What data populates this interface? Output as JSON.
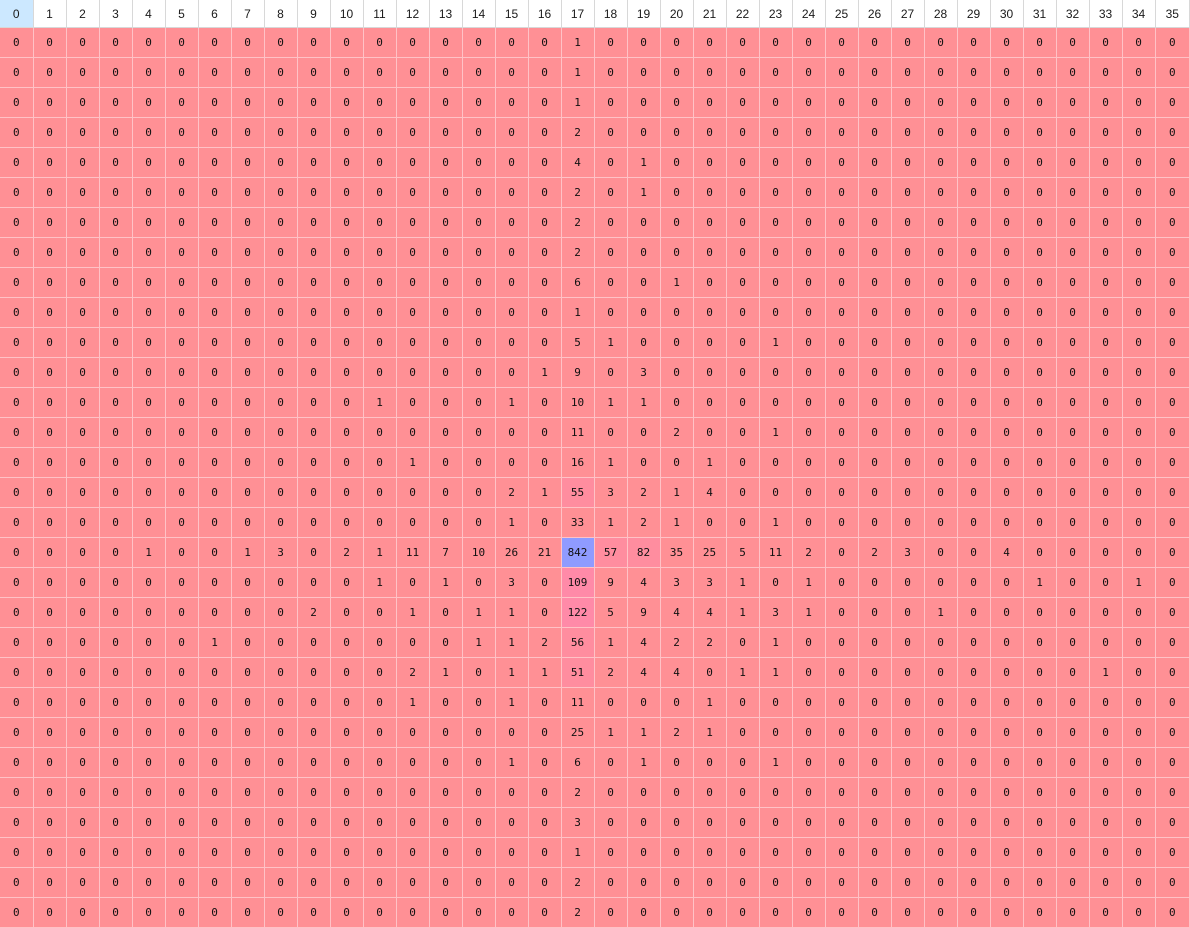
{
  "header": [
    "0",
    "1",
    "2",
    "3",
    "4",
    "5",
    "6",
    "7",
    "8",
    "9",
    "10",
    "11",
    "12",
    "13",
    "14",
    "15",
    "16",
    "17",
    "18",
    "19",
    "20",
    "21",
    "22",
    "23",
    "24",
    "25",
    "26",
    "27",
    "28",
    "29",
    "30",
    "31",
    "32",
    "33",
    "34",
    "35"
  ],
  "selected_header_index": 0,
  "colors": {
    "base_cell": "#ff9095",
    "mid_cell": "#ff8aa8",
    "high_cell": "#8f9bff",
    "cell_border": "#ffc2c6",
    "header_selected": "#cce8ff"
  },
  "rows": [
    [
      0,
      0,
      0,
      0,
      0,
      0,
      0,
      0,
      0,
      0,
      0,
      0,
      0,
      0,
      0,
      0,
      0,
      1,
      0,
      0,
      0,
      0,
      0,
      0,
      0,
      0,
      0,
      0,
      0,
      0,
      0,
      0,
      0,
      0,
      0,
      0
    ],
    [
      0,
      0,
      0,
      0,
      0,
      0,
      0,
      0,
      0,
      0,
      0,
      0,
      0,
      0,
      0,
      0,
      0,
      1,
      0,
      0,
      0,
      0,
      0,
      0,
      0,
      0,
      0,
      0,
      0,
      0,
      0,
      0,
      0,
      0,
      0,
      0
    ],
    [
      0,
      0,
      0,
      0,
      0,
      0,
      0,
      0,
      0,
      0,
      0,
      0,
      0,
      0,
      0,
      0,
      0,
      1,
      0,
      0,
      0,
      0,
      0,
      0,
      0,
      0,
      0,
      0,
      0,
      0,
      0,
      0,
      0,
      0,
      0,
      0
    ],
    [
      0,
      0,
      0,
      0,
      0,
      0,
      0,
      0,
      0,
      0,
      0,
      0,
      0,
      0,
      0,
      0,
      0,
      2,
      0,
      0,
      0,
      0,
      0,
      0,
      0,
      0,
      0,
      0,
      0,
      0,
      0,
      0,
      0,
      0,
      0,
      0
    ],
    [
      0,
      0,
      0,
      0,
      0,
      0,
      0,
      0,
      0,
      0,
      0,
      0,
      0,
      0,
      0,
      0,
      0,
      4,
      0,
      1,
      0,
      0,
      0,
      0,
      0,
      0,
      0,
      0,
      0,
      0,
      0,
      0,
      0,
      0,
      0,
      0
    ],
    [
      0,
      0,
      0,
      0,
      0,
      0,
      0,
      0,
      0,
      0,
      0,
      0,
      0,
      0,
      0,
      0,
      0,
      2,
      0,
      1,
      0,
      0,
      0,
      0,
      0,
      0,
      0,
      0,
      0,
      0,
      0,
      0,
      0,
      0,
      0,
      0
    ],
    [
      0,
      0,
      0,
      0,
      0,
      0,
      0,
      0,
      0,
      0,
      0,
      0,
      0,
      0,
      0,
      0,
      0,
      2,
      0,
      0,
      0,
      0,
      0,
      0,
      0,
      0,
      0,
      0,
      0,
      0,
      0,
      0,
      0,
      0,
      0,
      0
    ],
    [
      0,
      0,
      0,
      0,
      0,
      0,
      0,
      0,
      0,
      0,
      0,
      0,
      0,
      0,
      0,
      0,
      0,
      2,
      0,
      0,
      0,
      0,
      0,
      0,
      0,
      0,
      0,
      0,
      0,
      0,
      0,
      0,
      0,
      0,
      0,
      0
    ],
    [
      0,
      0,
      0,
      0,
      0,
      0,
      0,
      0,
      0,
      0,
      0,
      0,
      0,
      0,
      0,
      0,
      0,
      6,
      0,
      0,
      1,
      0,
      0,
      0,
      0,
      0,
      0,
      0,
      0,
      0,
      0,
      0,
      0,
      0,
      0,
      0
    ],
    [
      0,
      0,
      0,
      0,
      0,
      0,
      0,
      0,
      0,
      0,
      0,
      0,
      0,
      0,
      0,
      0,
      0,
      1,
      0,
      0,
      0,
      0,
      0,
      0,
      0,
      0,
      0,
      0,
      0,
      0,
      0,
      0,
      0,
      0,
      0,
      0
    ],
    [
      0,
      0,
      0,
      0,
      0,
      0,
      0,
      0,
      0,
      0,
      0,
      0,
      0,
      0,
      0,
      0,
      0,
      5,
      1,
      0,
      0,
      0,
      0,
      1,
      0,
      0,
      0,
      0,
      0,
      0,
      0,
      0,
      0,
      0,
      0,
      0
    ],
    [
      0,
      0,
      0,
      0,
      0,
      0,
      0,
      0,
      0,
      0,
      0,
      0,
      0,
      0,
      0,
      0,
      1,
      9,
      0,
      3,
      0,
      0,
      0,
      0,
      0,
      0,
      0,
      0,
      0,
      0,
      0,
      0,
      0,
      0,
      0,
      0
    ],
    [
      0,
      0,
      0,
      0,
      0,
      0,
      0,
      0,
      0,
      0,
      0,
      1,
      0,
      0,
      0,
      1,
      0,
      10,
      1,
      1,
      0,
      0,
      0,
      0,
      0,
      0,
      0,
      0,
      0,
      0,
      0,
      0,
      0,
      0,
      0,
      0
    ],
    [
      0,
      0,
      0,
      0,
      0,
      0,
      0,
      0,
      0,
      0,
      0,
      0,
      0,
      0,
      0,
      0,
      0,
      11,
      0,
      0,
      2,
      0,
      0,
      1,
      0,
      0,
      0,
      0,
      0,
      0,
      0,
      0,
      0,
      0,
      0,
      0
    ],
    [
      0,
      0,
      0,
      0,
      0,
      0,
      0,
      0,
      0,
      0,
      0,
      0,
      1,
      0,
      0,
      0,
      0,
      16,
      1,
      0,
      0,
      1,
      0,
      0,
      0,
      0,
      0,
      0,
      0,
      0,
      0,
      0,
      0,
      0,
      0,
      0
    ],
    [
      0,
      0,
      0,
      0,
      0,
      0,
      0,
      0,
      0,
      0,
      0,
      0,
      0,
      0,
      0,
      2,
      1,
      55,
      3,
      2,
      1,
      4,
      0,
      0,
      0,
      0,
      0,
      0,
      0,
      0,
      0,
      0,
      0,
      0,
      0,
      0
    ],
    [
      0,
      0,
      0,
      0,
      0,
      0,
      0,
      0,
      0,
      0,
      0,
      0,
      0,
      0,
      0,
      1,
      0,
      33,
      1,
      2,
      1,
      0,
      0,
      1,
      0,
      0,
      0,
      0,
      0,
      0,
      0,
      0,
      0,
      0,
      0,
      0
    ],
    [
      0,
      0,
      0,
      0,
      1,
      0,
      0,
      1,
      3,
      0,
      2,
      1,
      11,
      7,
      10,
      26,
      21,
      842,
      57,
      82,
      35,
      25,
      5,
      11,
      2,
      0,
      2,
      3,
      0,
      0,
      4,
      0,
      0,
      0,
      0,
      0
    ],
    [
      0,
      0,
      0,
      0,
      0,
      0,
      0,
      0,
      0,
      0,
      0,
      1,
      0,
      1,
      0,
      3,
      0,
      109,
      9,
      4,
      3,
      3,
      1,
      0,
      1,
      0,
      0,
      0,
      0,
      0,
      0,
      1,
      0,
      0,
      1,
      0
    ],
    [
      0,
      0,
      0,
      0,
      0,
      0,
      0,
      0,
      0,
      2,
      0,
      0,
      1,
      0,
      1,
      1,
      0,
      122,
      5,
      9,
      4,
      4,
      1,
      3,
      1,
      0,
      0,
      0,
      1,
      0,
      0,
      0,
      0,
      0,
      0,
      0
    ],
    [
      0,
      0,
      0,
      0,
      0,
      0,
      1,
      0,
      0,
      0,
      0,
      0,
      0,
      0,
      1,
      1,
      2,
      56,
      1,
      4,
      2,
      2,
      0,
      1,
      0,
      0,
      0,
      0,
      0,
      0,
      0,
      0,
      0,
      0,
      0,
      0
    ],
    [
      0,
      0,
      0,
      0,
      0,
      0,
      0,
      0,
      0,
      0,
      0,
      0,
      2,
      1,
      0,
      1,
      1,
      51,
      2,
      4,
      4,
      0,
      1,
      1,
      0,
      0,
      0,
      0,
      0,
      0,
      0,
      0,
      0,
      1,
      0,
      0
    ],
    [
      0,
      0,
      0,
      0,
      0,
      0,
      0,
      0,
      0,
      0,
      0,
      0,
      1,
      0,
      0,
      1,
      0,
      11,
      0,
      0,
      0,
      1,
      0,
      0,
      0,
      0,
      0,
      0,
      0,
      0,
      0,
      0,
      0,
      0,
      0,
      0
    ],
    [
      0,
      0,
      0,
      0,
      0,
      0,
      0,
      0,
      0,
      0,
      0,
      0,
      0,
      0,
      0,
      0,
      0,
      25,
      1,
      1,
      2,
      1,
      0,
      0,
      0,
      0,
      0,
      0,
      0,
      0,
      0,
      0,
      0,
      0,
      0,
      0
    ],
    [
      0,
      0,
      0,
      0,
      0,
      0,
      0,
      0,
      0,
      0,
      0,
      0,
      0,
      0,
      0,
      1,
      0,
      6,
      0,
      1,
      0,
      0,
      0,
      1,
      0,
      0,
      0,
      0,
      0,
      0,
      0,
      0,
      0,
      0,
      0,
      0
    ],
    [
      0,
      0,
      0,
      0,
      0,
      0,
      0,
      0,
      0,
      0,
      0,
      0,
      0,
      0,
      0,
      0,
      0,
      2,
      0,
      0,
      0,
      0,
      0,
      0,
      0,
      0,
      0,
      0,
      0,
      0,
      0,
      0,
      0,
      0,
      0,
      0
    ],
    [
      0,
      0,
      0,
      0,
      0,
      0,
      0,
      0,
      0,
      0,
      0,
      0,
      0,
      0,
      0,
      0,
      0,
      3,
      0,
      0,
      0,
      0,
      0,
      0,
      0,
      0,
      0,
      0,
      0,
      0,
      0,
      0,
      0,
      0,
      0,
      0
    ],
    [
      0,
      0,
      0,
      0,
      0,
      0,
      0,
      0,
      0,
      0,
      0,
      0,
      0,
      0,
      0,
      0,
      0,
      1,
      0,
      0,
      0,
      0,
      0,
      0,
      0,
      0,
      0,
      0,
      0,
      0,
      0,
      0,
      0,
      0,
      0,
      0
    ],
    [
      0,
      0,
      0,
      0,
      0,
      0,
      0,
      0,
      0,
      0,
      0,
      0,
      0,
      0,
      0,
      0,
      0,
      2,
      0,
      0,
      0,
      0,
      0,
      0,
      0,
      0,
      0,
      0,
      0,
      0,
      0,
      0,
      0,
      0,
      0,
      0
    ],
    [
      0,
      0,
      0,
      0,
      0,
      0,
      0,
      0,
      0,
      0,
      0,
      0,
      0,
      0,
      0,
      0,
      0,
      2,
      0,
      0,
      0,
      0,
      0,
      0,
      0,
      0,
      0,
      0,
      0,
      0,
      0,
      0,
      0,
      0,
      0,
      0
    ]
  ]
}
